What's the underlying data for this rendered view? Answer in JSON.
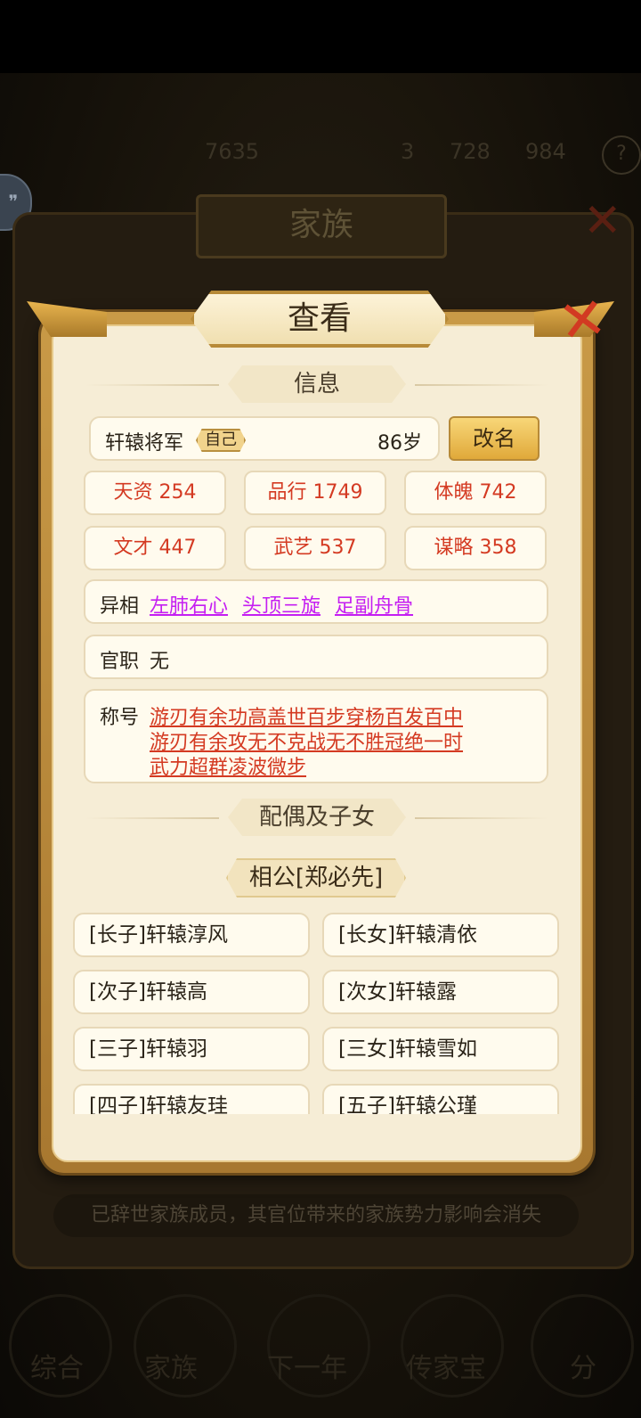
{
  "background": {
    "stats_text": [
      "",
      "7635",
      "3",
      "728",
      "984"
    ],
    "family_title": "家族",
    "notice": "已辞世家族成员，其官位带来的家族势力影响会消失",
    "nav": [
      "综合",
      "家族",
      "下一年",
      "传家宝",
      "分"
    ]
  },
  "dialog": {
    "title": "查看",
    "info_section": "信息",
    "name": "轩辕将军",
    "self_tag": "自己",
    "age": "86岁",
    "rename_label": "改名",
    "stats": [
      "天资 254",
      "品行 1749",
      "体魄 742",
      "文才 447",
      "武艺 537",
      "谋略 358"
    ],
    "traits_label": "异相",
    "traits": [
      "左肺右心",
      "头顶三旋",
      "足副舟骨"
    ],
    "office_label": "官职",
    "office_value": "无",
    "titles_label": "称号",
    "titles_lines": [
      "游刃有余功高盖世百步穿杨百发百中",
      "游刃有余攻无不克战无不胜冠绝一时",
      "武力超群凌波微步"
    ],
    "family_section": "配偶及子女",
    "spouse": "相公[郑必先]",
    "children": [
      "[长子]轩辕淳风",
      "[长女]轩辕清依",
      "[次子]轩辕高",
      "[次女]轩辕露",
      "[三子]轩辕羽",
      "[三女]轩辕雪如",
      "[四子]轩辕友珪",
      "[五子]轩辕公瑾"
    ]
  },
  "colors": {
    "stat_red": "#d43a22",
    "trait_purple": "#c51ef2",
    "gold": "#e0a93a"
  },
  "icons": {
    "close": "close-x-icon",
    "chat": "chat-bubble-icon",
    "help": "help-icon"
  }
}
